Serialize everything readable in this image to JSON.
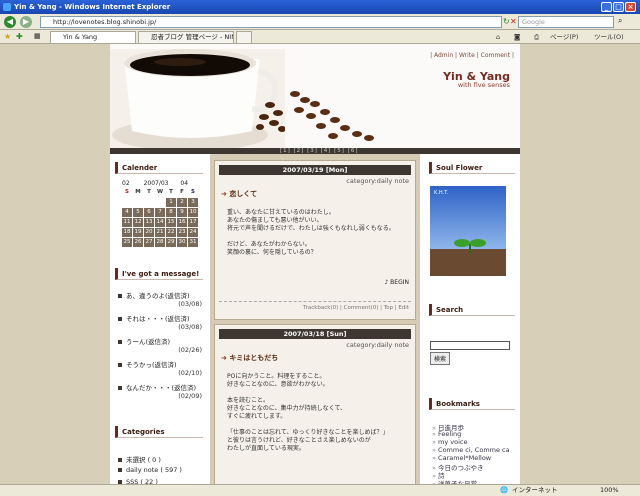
{
  "window": {
    "title": "Yin & Yang - Windows Internet Explorer"
  },
  "address": {
    "url": "http://lovenotes.blog.shinobi.jp/",
    "search_placeholder": "Google"
  },
  "tabs": [
    {
      "label": "Yin & Yang"
    },
    {
      "label": "忍者ブログ 管理ページ - NIN..."
    }
  ],
  "toolbar": {
    "page": "ページ(P)",
    "tools": "ツール(O)"
  },
  "blog": {
    "title": "Yin & Yang",
    "subtitle": "with five senses",
    "nav": {
      "admin": "Admin",
      "write": "Write",
      "comment": "Comment"
    },
    "pages": "[1] [2] [3] [4] [5] [6]"
  },
  "calendar": {
    "heading": "Calender",
    "prev": "02",
    "current": "2007/03",
    "next": "04",
    "weekdays": [
      "S",
      "M",
      "T",
      "W",
      "T",
      "F",
      "S"
    ],
    "weeks": [
      [
        "",
        "",
        "",
        "",
        "1",
        "2",
        "3"
      ],
      [
        "4",
        "5",
        "6",
        "7",
        "8",
        "9",
        "10"
      ],
      [
        "11",
        "12",
        "13",
        "14",
        "15",
        "16",
        "17"
      ],
      [
        "18",
        "19",
        "20",
        "21",
        "22",
        "23",
        "24"
      ],
      [
        "25",
        "26",
        "27",
        "28",
        "29",
        "30",
        "31"
      ]
    ]
  },
  "messages": {
    "heading": "I've got a message!",
    "items": [
      {
        "title": "あ、違うのよ(返信済)",
        "date": "(03/08)"
      },
      {
        "title": "それは・・・(返信済)",
        "date": "(03/08)"
      },
      {
        "title": "うーん(返信済)",
        "date": "(02/26)"
      },
      {
        "title": "そうかっ(返信済)",
        "date": "(02/10)"
      },
      {
        "title": "なんだか・・・(返信済)",
        "date": "(02/09)"
      }
    ]
  },
  "categories": {
    "heading": "Categories",
    "items": [
      {
        "label": "未選択 ( 0 )"
      },
      {
        "label": "daily note ( 597 )"
      },
      {
        "label": "SSS ( 22 )"
      }
    ]
  },
  "posts": [
    {
      "date": "2007/03/19 [Mon]",
      "category": "category:daily note",
      "title": "恋しくて",
      "body": "重い、あなたに甘えているのはわたし。\nあなたの傷ましても悪い他がいい。\n将元で声を聞けるだけで、わたしは強くもなれし弱くもなる。\n\nだけど、あなたがわからない。\n笑顔の裏に、何を隠しているの？",
      "sign": "♪ BEGIN",
      "footer": "Trackback(0) | Comment(0) | Top | Edit"
    },
    {
      "date": "2007/03/18 [Sun]",
      "category": "category:daily note",
      "title": "キミはともだち",
      "body": "POに向かうこと。料理をすること。\n好きなことなのに、意欲がわかない。\n\n本を読むこと。\n好きなことなのに、集中力が持続しなくて、\nすぐに疲れてします。\n\n「仕事のことは忘れて、ゆっくり好きなことを楽しめば？」\nと彼りは言うけれど、好きなことさえ楽しめないのが\nわたしが直面している現実。"
    }
  ],
  "soul_flower": {
    "heading": "Soul Flower",
    "caption": "K.H.T."
  },
  "search": {
    "heading": "Search",
    "button": "検索"
  },
  "bookmarks": {
    "heading": "Bookmarks",
    "items": [
      "日進月歩",
      "Feeling",
      "my voice",
      "Comme ci, Comme ca",
      "Caramel*Mellow",
      "今日のつぶやき",
      "詩",
      "洋菓子な日常"
    ]
  },
  "status": {
    "zone": "インターネット",
    "zoom": "100%"
  }
}
